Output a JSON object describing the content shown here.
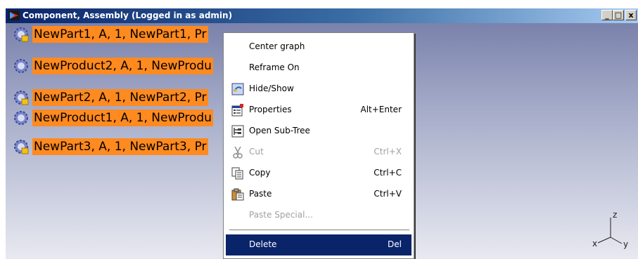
{
  "window": {
    "title": "Component, Assembly (Logged in as admin)",
    "buttons": {
      "minimize": "_",
      "maximize": "□",
      "close": "x"
    }
  },
  "tree": {
    "nodes": [
      {
        "label": "NewPart1, A, 1, NewPart1, Pr",
        "icon": "part-gear-icon"
      },
      {
        "label": "NewProduct2, A, 1, NewProdu",
        "icon": "product-gear-icon"
      },
      {
        "label": "NewPart2, A, 1, NewPart2, Pr",
        "icon": "part-gear-icon"
      },
      {
        "label": "NewProduct1, A, 1, NewProdu",
        "icon": "product-gear-icon"
      },
      {
        "label": "NewPart3, A, 1, NewPart3, Pr",
        "icon": "part-gear-icon"
      }
    ]
  },
  "context_menu": {
    "items": [
      {
        "label": "Center graph",
        "shortcut": "",
        "icon": "",
        "disabled": false
      },
      {
        "label": "Reframe On",
        "shortcut": "",
        "icon": "",
        "disabled": false
      },
      {
        "label": "Hide/Show",
        "shortcut": "",
        "icon": "hide-show-icon",
        "disabled": false
      },
      {
        "label": "Properties",
        "shortcut": "Alt+Enter",
        "icon": "properties-icon",
        "disabled": false
      },
      {
        "label": "Open Sub-Tree",
        "shortcut": "",
        "icon": "sub-tree-icon",
        "disabled": false
      },
      {
        "label": "Cut",
        "shortcut": "Ctrl+X",
        "icon": "scissors-icon",
        "disabled": true
      },
      {
        "label": "Copy",
        "shortcut": "Ctrl+C",
        "icon": "copy-icon",
        "disabled": false
      },
      {
        "label": "Paste",
        "shortcut": "Ctrl+V",
        "icon": "paste-icon",
        "disabled": false
      },
      {
        "label": "Paste Special...",
        "shortcut": "",
        "icon": "",
        "disabled": true
      },
      {
        "label": "Delete",
        "shortcut": "Del",
        "icon": "",
        "disabled": false,
        "selected": true
      }
    ]
  },
  "axis": {
    "x": "x",
    "y": "y",
    "z": "z"
  },
  "colors": {
    "selection_highlight": "#ff8a1f",
    "menu_selected": "#0a246a",
    "title_bar": "#0a246a"
  }
}
